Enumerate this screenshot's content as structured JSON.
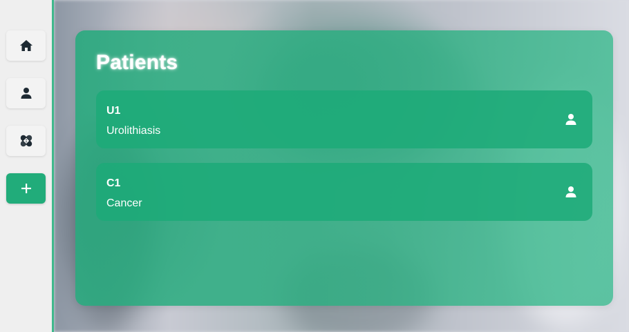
{
  "sidebar": {
    "items": [
      {
        "name": "home",
        "icon": "home-icon"
      },
      {
        "name": "profile",
        "icon": "user-icon"
      },
      {
        "name": "bandages",
        "icon": "bandage-icon"
      },
      {
        "name": "add",
        "icon": "plus-icon",
        "color": "#21ac7a"
      }
    ]
  },
  "main": {
    "title": "Patients",
    "patients": [
      {
        "id": "U1",
        "diagnosis": "Urolithiasis",
        "icon": "user-icon"
      },
      {
        "id": "C1",
        "diagnosis": "Cancer",
        "icon": "user-icon"
      }
    ]
  },
  "colors": {
    "accent": "#21ac7a",
    "sidebar_border": "#3fb98c"
  }
}
